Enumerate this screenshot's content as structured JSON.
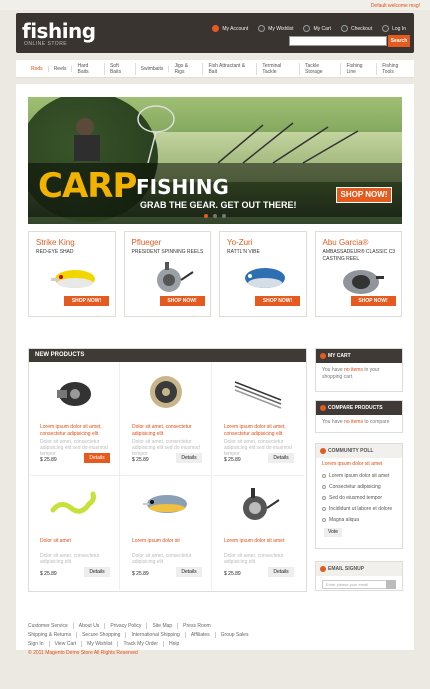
{
  "welcome": "Default welcome msg!",
  "logo": {
    "text": "fishing",
    "subtitle": "ONLINE STORE"
  },
  "header_links": [
    "My Account",
    "My Wishlist",
    "My Cart",
    "Checkout",
    "Log In"
  ],
  "search": {
    "placeholder": "",
    "button": "Search"
  },
  "nav": [
    "Rods",
    "Reels",
    "Hard Baits",
    "Soft Baits",
    "Swimbaits",
    "Jigs & Rigs",
    "Fish Attractant & Bait",
    "Terminal Tackle",
    "Tackle Storage",
    "Fishing Line",
    "Fishing Tools"
  ],
  "hero": {
    "carp": "CARP",
    "fishing": "FISHING",
    "tagline": "GRAB THE GEAR. GET OUT THERE!",
    "button": "SHOP NOW!"
  },
  "featured": [
    {
      "brand": "Strike King",
      "subtitle": "RED-EYE SHAD",
      "button": "SHOP NOW!"
    },
    {
      "brand": "Pflueger",
      "subtitle": "PRESIDENT SPINNING REELS",
      "button": "SHOP NOW!"
    },
    {
      "brand": "Yo-Zuri",
      "subtitle": "RATTL'N VIBE",
      "button": "SHOP NOW!"
    },
    {
      "brand": "Abu Garcia®",
      "subtitle": "AMBASSADEUR® CLASSIC C3 CASTING REEL",
      "button": "SHOP NOW!"
    }
  ],
  "new_products": {
    "title": "NEW PRODUCTS",
    "items": [
      {
        "title": "Lorem ipsum dolor sit amet, consectetur adipisicing elit",
        "desc": "Dolor sit amet, consectetur adipisicing elit sed do eiusmod tempor",
        "price": "$ 25.89",
        "btn": "Details"
      },
      {
        "title": "Dolor sit amet, consectetur adipisicing elit",
        "desc": "Dolor sit amet, consectetur adipisicing elit sed do eiusmod tempor",
        "price": "$ 25.89",
        "btn": "Details"
      },
      {
        "title": "Lorem ipsum dolor sit amet, consectetur adipisicing elit",
        "desc": "Dolor sit amet, consectetur adipisicing elit sed do eiusmod tempor",
        "price": "$ 25.89",
        "btn": "Details"
      },
      {
        "title": "Dolor sit amet",
        "desc": "Dolor sit amet, consectetur adipisicing elit",
        "price": "$ 25.89",
        "btn": "Details"
      },
      {
        "title": "Lorem ipsum dolor sit",
        "desc": "Dolor sit amet, consectetur adipisicing elit",
        "price": "$ 25.89",
        "btn": "Details"
      },
      {
        "title": "Lorem ipsum dolor sit amet",
        "desc": "Dolor sit amet, consectetur adipisicing elit",
        "price": "$ 25.89",
        "btn": "Details"
      }
    ]
  },
  "cart": {
    "title": "MY CART",
    "pre": "You have ",
    "link": "no items",
    "post": " in your shopping cart."
  },
  "compare": {
    "title": "COMPARE PRODUCTS",
    "pre": "You have ",
    "link": "no items",
    "post": " to compare"
  },
  "poll": {
    "title": "COMMUNITY POLL",
    "question": "Lorem ipsum dolor sit amet",
    "options": [
      "Lorem ipsum dolor sit amet",
      "Consectetur adipisicing",
      "Sed do eiusmod tempor",
      "Incididunt ut labore et dolore",
      "Magna aliqua"
    ],
    "button": "Vote"
  },
  "email": {
    "title": "EMAIL SIGNUP",
    "placeholder": "Enter please your email"
  },
  "footer": {
    "row1": [
      "Customer Service",
      "About Us",
      "Privacy Policy",
      "Site Map",
      "Press Room"
    ],
    "row2": [
      "Shipping & Returns",
      "Secure Shopping",
      "International Shipping",
      "Affiliates",
      "Group Sales"
    ],
    "row3": [
      "Sign In",
      "View Cart",
      "My Wishlist",
      "Track My Order",
      "Help"
    ],
    "copyright": "© 2011 Magento Demo Store All Rights Reserved"
  },
  "colors": {
    "accent": "#e55b1f",
    "dark": "#3a3431"
  }
}
